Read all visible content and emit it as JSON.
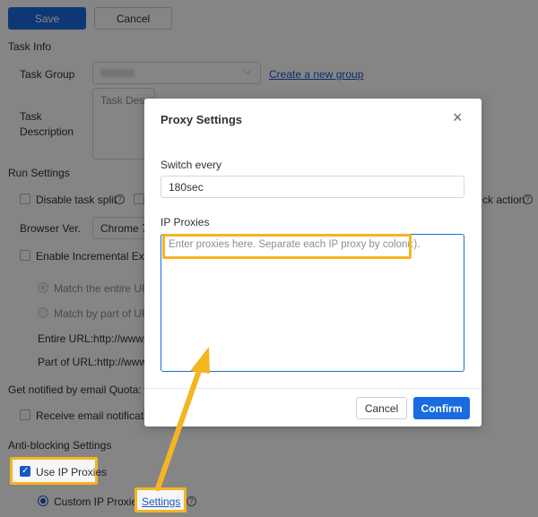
{
  "toolbar": {
    "save_label": "Save",
    "cancel_label": "Cancel"
  },
  "task_info": {
    "section_title": "Task Info",
    "task_group_label": "Task Group",
    "task_group_value": "",
    "create_group_link": "Create a new group",
    "task_description_label_1": "Task",
    "task_description_label_2": "Description",
    "task_description_placeholder": "Task Description"
  },
  "run_settings": {
    "section_title": "Run Settings",
    "disable_task_split_label": "Disable task split",
    "block_action_label": "ck action",
    "browser_version_label": "Browser Ver.",
    "browser_version_value": "Chrome 7",
    "incremental_label": "Enable Incremental Extra",
    "match_entire_label": "Match the entire URL",
    "match_part_label": "Match by part of URL",
    "entire_url_label": "Entire URL:http://www.de",
    "part_url_label": "Part of URL:http://www.c"
  },
  "notify": {
    "quota_label": "Get notified by email Quota: 0/",
    "receive_email_label": "Receive email notification"
  },
  "anti_blocking": {
    "section_title": "Anti-blocking Settings",
    "use_ip_proxies_label": "Use IP Proxies",
    "custom_ip_proxies_label": "Custom IP Proxies",
    "settings_link": "Settings"
  },
  "dialog": {
    "title": "Proxy Settings",
    "switch_every_label": "Switch every",
    "switch_every_value": "180sec",
    "ip_proxies_label": "IP Proxies",
    "ip_proxies_placeholder": "Enter proxies here. Separate each IP proxy by colon(:).",
    "cancel_label": "Cancel",
    "confirm_label": "Confirm"
  },
  "icons": {
    "help": "?",
    "close": "×",
    "check": "✓"
  },
  "colors": {
    "primary": "#1a6be0",
    "highlight": "#f5b521",
    "link": "#1a56c8"
  }
}
